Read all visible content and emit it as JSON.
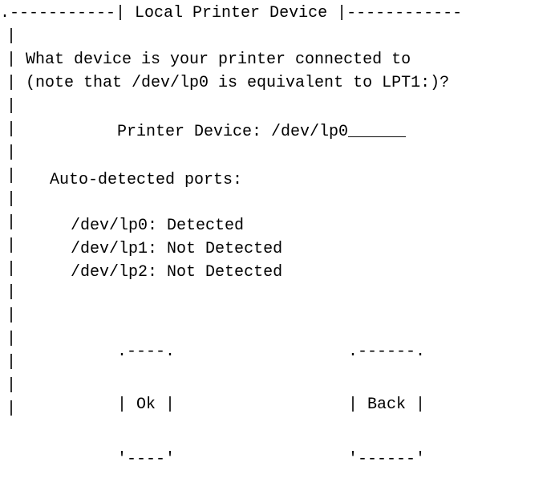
{
  "dialog": {
    "title_left_rule": ".-----------|",
    "title": " Local Printer Device ",
    "title_right_rule": "|------------",
    "left_border": "|\n|\n|\n|\n|\n|\n|\n|\n|\n|\n|\n|\n|\n|\n|\n|\n|",
    "prompt_line_1": "What device is your printer connected to",
    "prompt_line_2": "(note that /dev/lp0 is equivalent to LPT1:)?"
  },
  "field": {
    "label": "Printer Device: ",
    "value": "/dev/lp0",
    "fill": "______"
  },
  "ports": {
    "label": "Auto-detected ports:",
    "items": [
      {
        "device": "/dev/lp0:",
        "status": "Detected"
      },
      {
        "device": "/dev/lp1:",
        "status": "Not Detected"
      },
      {
        "device": "/dev/lp2:",
        "status": "Not Detected"
      }
    ]
  },
  "buttons": {
    "ok": {
      "top": ".----.",
      "label": "| Ok |",
      "bottom": "'----'"
    },
    "back": {
      "top": ".------.",
      "label": "| Back |",
      "bottom": "'------'"
    }
  }
}
